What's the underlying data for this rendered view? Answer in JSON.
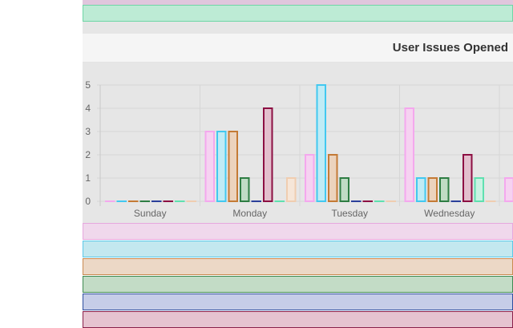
{
  "chart_title": "User Issues Opened",
  "legend_top": {
    "label": "",
    "fill": "#bdebd5",
    "border": "#6fd6a6"
  },
  "legend_bottom": [
    {
      "label": "",
      "fill": "#f0d8ec",
      "border": "#e6a8de"
    },
    {
      "label": "",
      "fill": "#c3e8ef",
      "border": "#5ac8e8"
    },
    {
      "label": "",
      "fill": "#ecd8c6",
      "border": "#c98a50"
    },
    {
      "label": "",
      "fill": "#c3dcc6",
      "border": "#3f8a52"
    },
    {
      "label": "",
      "fill": "#c6cde8",
      "border": "#2f4fa0"
    },
    {
      "label": "",
      "fill": "#e6c3d0",
      "border": "#8a1f4a"
    }
  ],
  "chart_data": {
    "type": "bar",
    "title": "User Issues Opened",
    "categories": [
      "Sunday",
      "Monday",
      "Tuesday",
      "Wednesday"
    ],
    "ylim": [
      0,
      5
    ],
    "yticks": [
      0,
      1,
      2,
      3,
      4,
      5
    ],
    "grid": true,
    "series": [
      {
        "color": "#f4a8ee",
        "fill": "#f6d2f1",
        "values": [
          0,
          3,
          2,
          4
        ]
      },
      {
        "color": "#42c8f0",
        "fill": "#c0ebf5",
        "values": [
          0,
          3,
          5,
          1
        ]
      },
      {
        "color": "#c47a35",
        "fill": "#ecd3bd",
        "values": [
          0,
          3,
          2,
          1
        ]
      },
      {
        "color": "#2e7d43",
        "fill": "#c0dcc5",
        "values": [
          0,
          1,
          1,
          1
        ]
      },
      {
        "color": "#2b3f9a",
        "fill": "#c6cce6",
        "values": [
          0,
          0,
          0,
          0
        ]
      },
      {
        "color": "#8c0f42",
        "fill": "#e3bfcd",
        "values": [
          0,
          4,
          0,
          2
        ]
      },
      {
        "color": "#5fe0b0",
        "fill": "#c9f3e3",
        "values": [
          0,
          0,
          0,
          1
        ]
      },
      {
        "color": "#f0cdb0",
        "fill": "#f6e6d8",
        "values": [
          0,
          1,
          0,
          0
        ]
      }
    ],
    "offscreen_bar": {
      "color": "#f4a8ee",
      "fill": "#f6d2f1",
      "value": 1
    }
  }
}
